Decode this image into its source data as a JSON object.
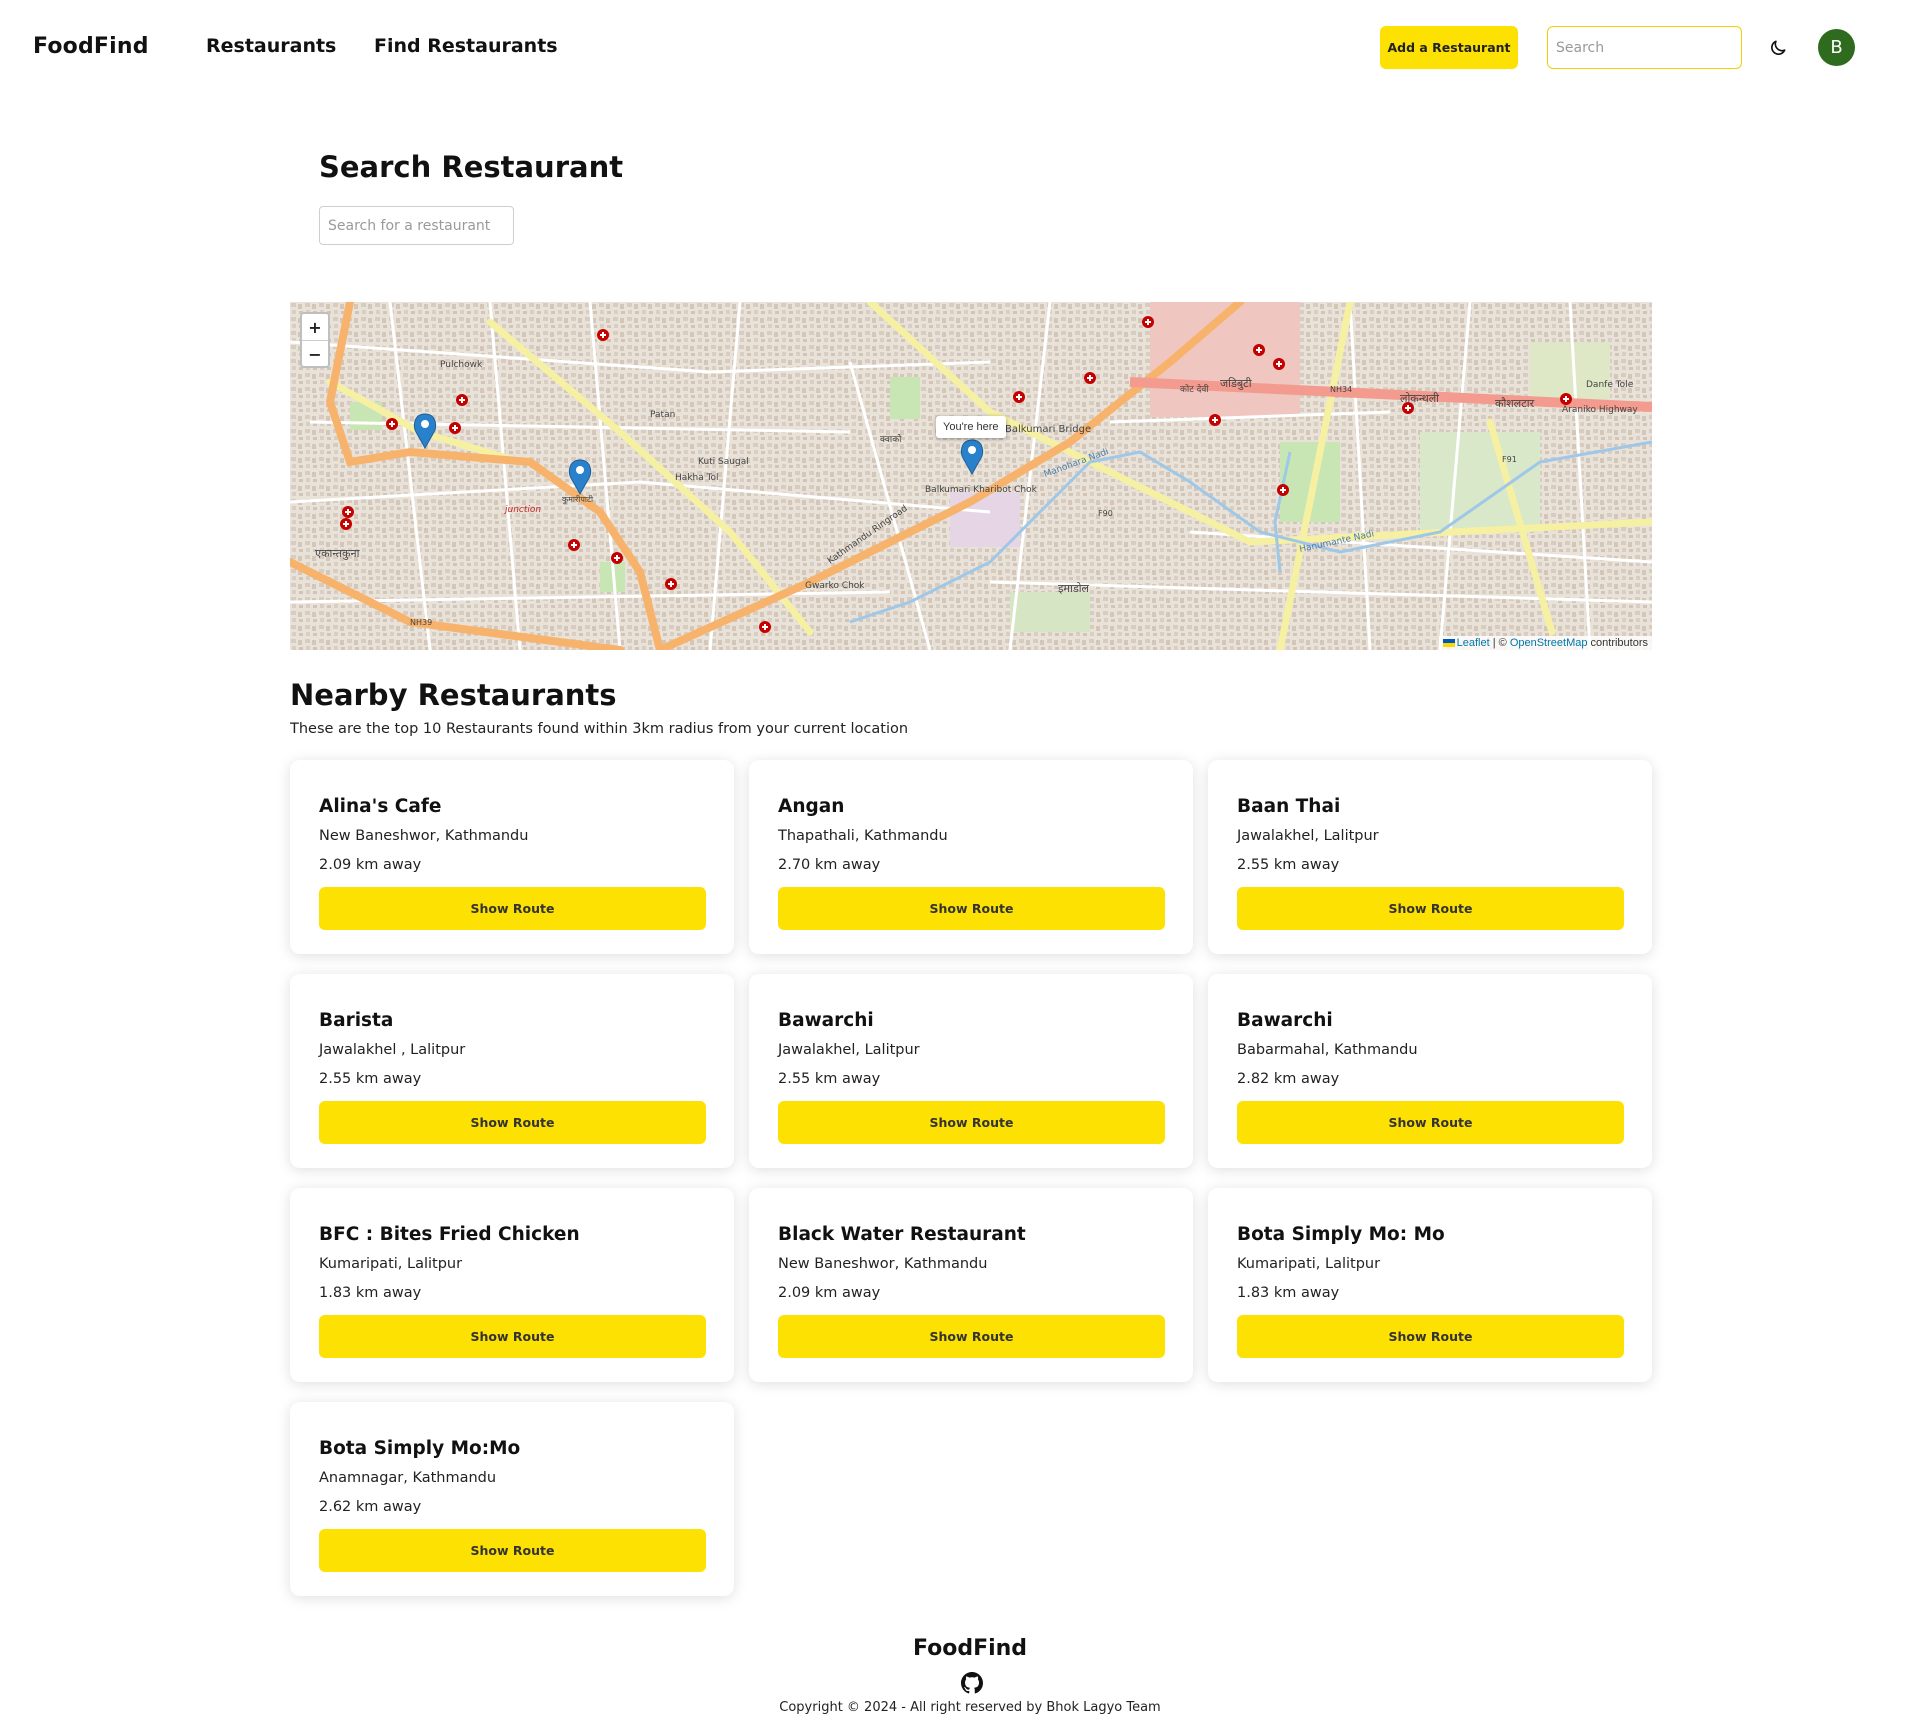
{
  "navbar": {
    "brand": "FoodFind",
    "links": [
      "Restaurants",
      "Find Restaurants"
    ],
    "add_button": "Add a Restaurant",
    "search_placeholder": "Search",
    "theme_icon": "moon-icon",
    "avatar_initial": "B"
  },
  "search_section": {
    "title": "Search Restaurant",
    "placeholder": "Search for a restaurant"
  },
  "map": {
    "zoom_in": "+",
    "zoom_out": "−",
    "popup": "You're here",
    "attribution": {
      "leaflet": "Leaflet",
      "separator": " | © ",
      "osm": "OpenStreetMap",
      "suffix": " contributors"
    },
    "labels": [
      "Pulchowk",
      "Patan",
      "Kuti Saugal",
      "Hakha Tol",
      "Gwarko Chok",
      "Balkumari Bridge",
      "Balkumari Kharibot Chok",
      "Kathmandu Ringroad",
      "junction",
      "NH34",
      "NH39",
      "F90",
      "F91",
      "Araniko Highway",
      "Danfe Tole",
      "Manohara Nadi",
      "Hanumante Nadi",
      "कोट देवी",
      "जडिबुटी",
      "लोकन्थली",
      "कौशलटार",
      "इमाडोल",
      "एकान्तकुना",
      "क्वाकोे",
      "कुमारीपाटी"
    ]
  },
  "nearby": {
    "title": "Nearby Restaurants",
    "subtitle": "These are the top 10 Restaurants found within 3km radius from your current location",
    "button_label": "Show Route",
    "restaurants": [
      {
        "name": "Alina's Cafe",
        "address": "New Baneshwor, Kathmandu",
        "distance": "2.09 km away"
      },
      {
        "name": "Angan",
        "address": "Thapathali, Kathmandu",
        "distance": "2.70 km away"
      },
      {
        "name": "Baan Thai",
        "address": "Jawalakhel, Lalitpur",
        "distance": "2.55 km away"
      },
      {
        "name": "Barista",
        "address": "Jawalakhel , Lalitpur",
        "distance": "2.55 km away"
      },
      {
        "name": "Bawarchi",
        "address": "Jawalakhel, Lalitpur",
        "distance": "2.55 km away"
      },
      {
        "name": "Bawarchi",
        "address": "Babarmahal, Kathmandu",
        "distance": "2.82 km away"
      },
      {
        "name": "BFC : Bites Fried Chicken",
        "address": "Kumaripati, Lalitpur",
        "distance": "1.83 km away"
      },
      {
        "name": "Black Water Restaurant",
        "address": "New Baneshwor, Kathmandu",
        "distance": "2.09 km away"
      },
      {
        "name": "Bota Simply Mo: Mo",
        "address": "Kumaripati, Lalitpur",
        "distance": "1.83 km away"
      },
      {
        "name": "Bota Simply Mo:Mo",
        "address": "Anamnagar, Kathmandu",
        "distance": "2.62 km away"
      }
    ]
  },
  "footer": {
    "brand": "FoodFind",
    "icon": "github-icon",
    "copyright": "Copyright © 2024 - All right reserved by Bhok Lagyo Team"
  },
  "colors": {
    "accent": "#fde102",
    "avatar": "#2f6b1e",
    "marker": "#2a81cb",
    "hospital": "#c40000"
  }
}
